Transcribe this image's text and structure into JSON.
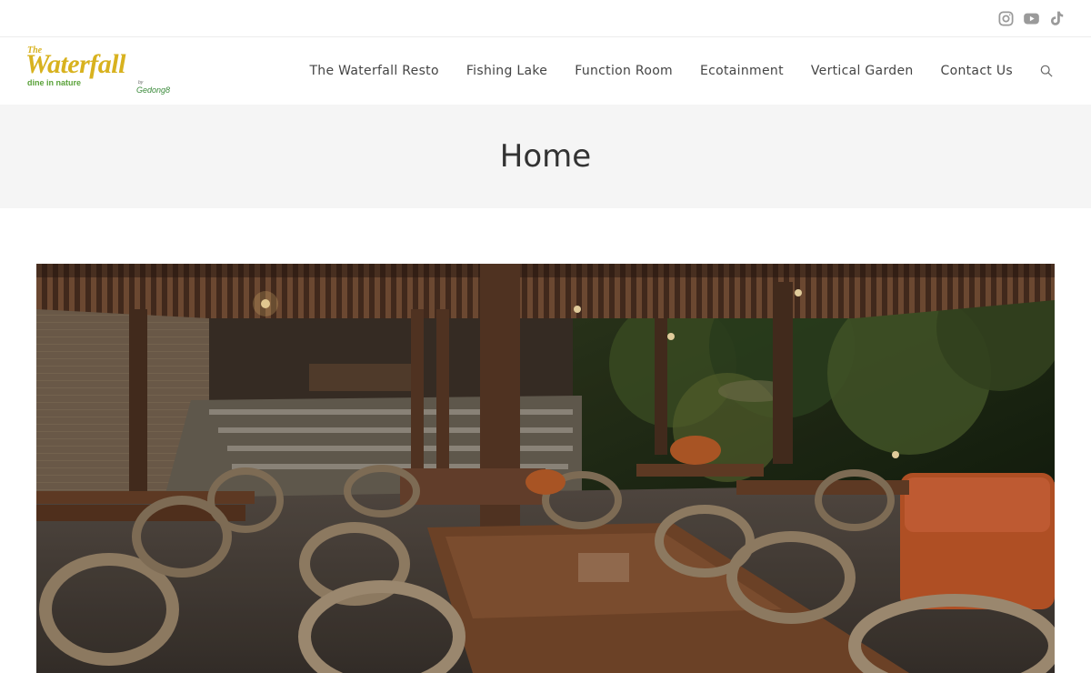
{
  "social": {
    "icons": [
      "instagram-icon",
      "youtube-icon",
      "tiktok-icon"
    ],
    "color": "#9a9a9a"
  },
  "logo": {
    "the": "The",
    "name": "Waterfall",
    "tagline": "dine in nature",
    "by": "by",
    "brand": "Gedong8"
  },
  "nav": {
    "items": [
      {
        "label": "The Waterfall Resto"
      },
      {
        "label": "Fishing Lake"
      },
      {
        "label": "Function Room"
      },
      {
        "label": "Ecotainment"
      },
      {
        "label": "Vertical Garden"
      },
      {
        "label": "Contact Us"
      }
    ],
    "search_icon": "search-icon"
  },
  "page": {
    "title": "Home"
  },
  "colors": {
    "logo_gold": "#d8b21f",
    "logo_green": "#5aa23a",
    "title_band": "#f5f5f5",
    "text": "#333333"
  }
}
